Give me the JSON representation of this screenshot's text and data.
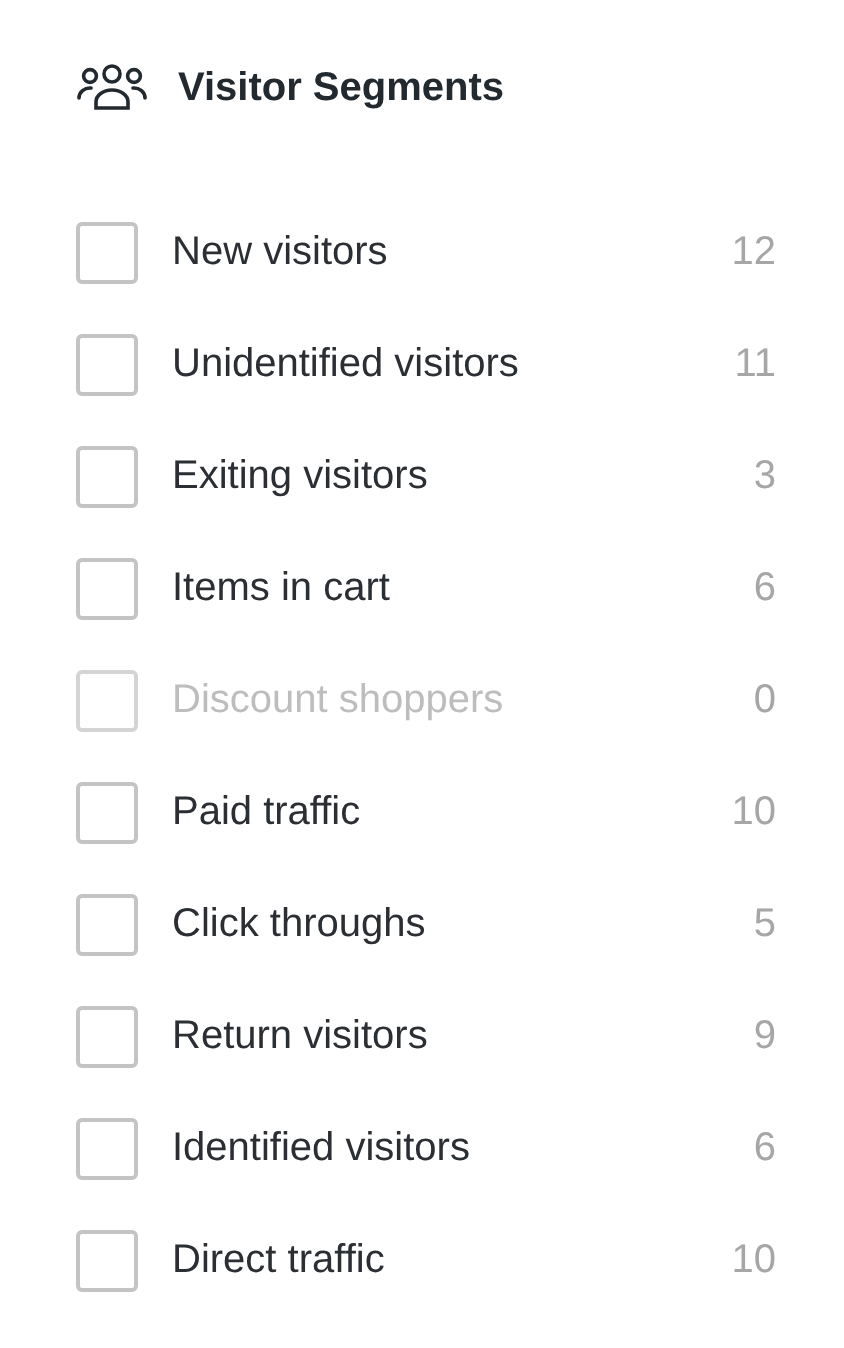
{
  "header": {
    "title": "Visitor Segments"
  },
  "segments": [
    {
      "label": "New visitors",
      "count": "12",
      "checked": false,
      "disabled": false
    },
    {
      "label": "Unidentified visitors",
      "count": "11",
      "checked": false,
      "disabled": false
    },
    {
      "label": "Exiting visitors",
      "count": "3",
      "checked": false,
      "disabled": false
    },
    {
      "label": "Items in cart",
      "count": "6",
      "checked": false,
      "disabled": false
    },
    {
      "label": "Discount shoppers",
      "count": "0",
      "checked": false,
      "disabled": true
    },
    {
      "label": "Paid traffic",
      "count": "10",
      "checked": false,
      "disabled": false
    },
    {
      "label": "Click throughs",
      "count": "5",
      "checked": false,
      "disabled": false
    },
    {
      "label": "Return visitors",
      "count": "9",
      "checked": false,
      "disabled": false
    },
    {
      "label": "Identified visitors",
      "count": "6",
      "checked": false,
      "disabled": false
    },
    {
      "label": "Direct traffic",
      "count": "10",
      "checked": false,
      "disabled": false
    }
  ]
}
